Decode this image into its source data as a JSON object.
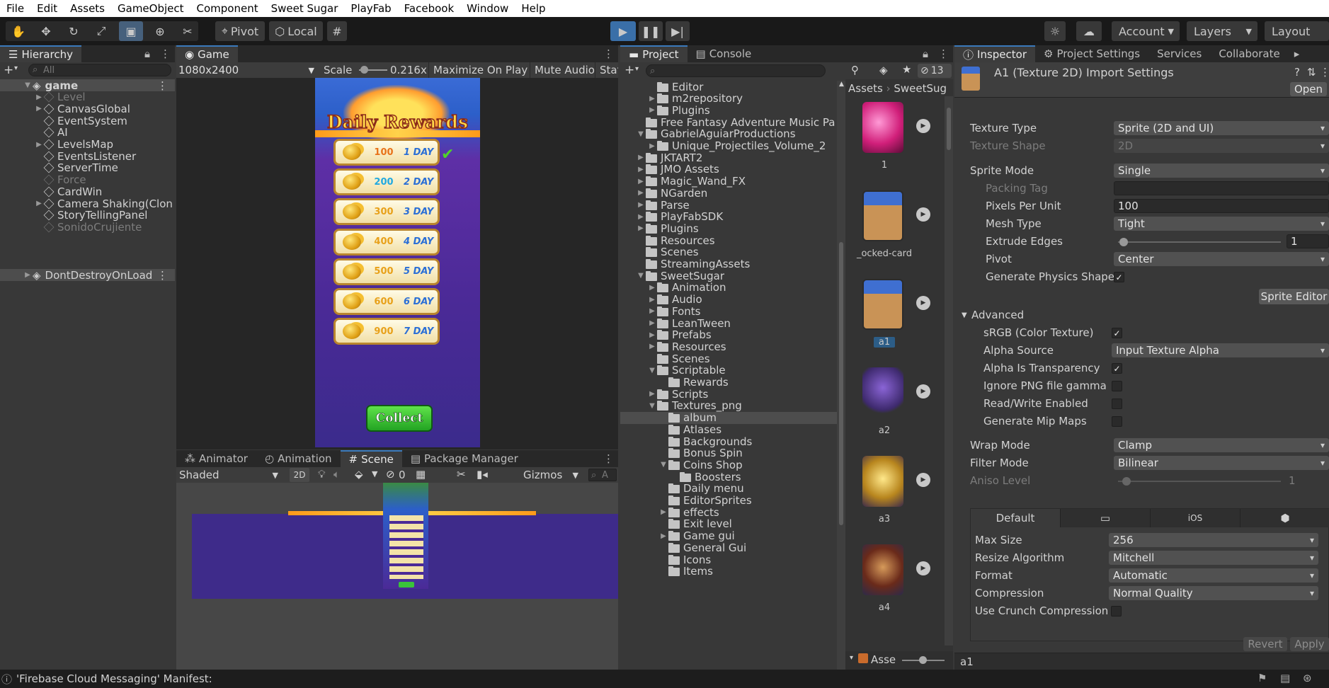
{
  "menubar": [
    "File",
    "Edit",
    "Assets",
    "GameObject",
    "Component",
    "Sweet Sugar",
    "PlayFab",
    "Facebook",
    "Window",
    "Help"
  ],
  "toolbar": {
    "pivot": "Pivot",
    "local": "Local",
    "account": "Account",
    "layers": "Layers",
    "layout": "Layout"
  },
  "hierarchy": {
    "tab": "Hierarchy",
    "search_placeholder": "All",
    "items": [
      {
        "label": "game",
        "depth": 0,
        "expand": "open",
        "kind": "scene",
        "selected": true
      },
      {
        "label": "Level",
        "depth": 1,
        "expand": "closed",
        "kind": "go",
        "dim": true
      },
      {
        "label": "CanvasGlobal",
        "depth": 1,
        "expand": "closed",
        "kind": "go"
      },
      {
        "label": "EventSystem",
        "depth": 1,
        "expand": "",
        "kind": "go"
      },
      {
        "label": "AI",
        "depth": 1,
        "expand": "",
        "kind": "go"
      },
      {
        "label": "LevelsMap",
        "depth": 1,
        "expand": "closed",
        "kind": "go"
      },
      {
        "label": "EventsListener",
        "depth": 1,
        "expand": "",
        "kind": "go"
      },
      {
        "label": "ServerTime",
        "depth": 1,
        "expand": "",
        "kind": "go"
      },
      {
        "label": "Force",
        "depth": 1,
        "expand": "",
        "kind": "go",
        "dim": true
      },
      {
        "label": "CardWin",
        "depth": 1,
        "expand": "",
        "kind": "go"
      },
      {
        "label": "Camera Shaking(Clon",
        "depth": 1,
        "expand": "closed",
        "kind": "go"
      },
      {
        "label": "StoryTellingPanel",
        "depth": 1,
        "expand": "",
        "kind": "go"
      },
      {
        "label": "SonidoCrujiente",
        "depth": 1,
        "expand": "",
        "kind": "go",
        "dim": true
      },
      {
        "label": "DontDestroyOnLoad",
        "depth": 0,
        "expand": "closed",
        "kind": "scene",
        "selected": true
      }
    ]
  },
  "game": {
    "tab": "Game",
    "resolution": "1080x2400",
    "scale_label": "Scale",
    "scale_value": "0.216x",
    "maximize": "Maximize On Play",
    "mute": "Mute Audio",
    "stats": "Stats",
    "title": "Daily Rewards",
    "collect": "Collect",
    "rewards": [
      {
        "amount": "100",
        "day": "1 DAY",
        "color": "#e8731a"
      },
      {
        "amount": "200",
        "day": "2 DAY",
        "color": "#21a9e0"
      },
      {
        "amount": "300",
        "day": "3 DAY",
        "color": "#e8a11a"
      },
      {
        "amount": "400",
        "day": "4 DAY",
        "color": "#e8a11a"
      },
      {
        "amount": "500",
        "day": "5 DAY",
        "color": "#e8a11a"
      },
      {
        "amount": "600",
        "day": "6 DAY",
        "color": "#e8a11a"
      },
      {
        "amount": "900",
        "day": "7 DAY",
        "color": "#e8a11a"
      }
    ]
  },
  "bottom_tabs": {
    "animator": "Animator",
    "animation": "Animation",
    "scene": "Scene",
    "package_manager": "Package Manager"
  },
  "scene_toolbar": {
    "shading": "Shaded",
    "mode2d": "2D",
    "hidden_count": "0",
    "gizmos": "Gizmos",
    "search": "A"
  },
  "project": {
    "tab": "Project",
    "console_tab": "Console",
    "hidden_count": "13",
    "breadcrumb": [
      "Assets",
      "SweetSug"
    ],
    "tree": [
      {
        "label": "Editor",
        "depth": 1,
        "expand": ""
      },
      {
        "label": "m2repository",
        "depth": 1,
        "expand": "closed"
      },
      {
        "label": "Plugins",
        "depth": 1,
        "expand": "closed"
      },
      {
        "label": "Free Fantasy Adventure Music Pa",
        "depth": 0,
        "expand": ""
      },
      {
        "label": "GabrielAguiarProductions",
        "depth": 0,
        "expand": "open"
      },
      {
        "label": "Unique_Projectiles_Volume_2",
        "depth": 1,
        "expand": "closed"
      },
      {
        "label": "JKTART2",
        "depth": 0,
        "expand": "closed"
      },
      {
        "label": "JMO Assets",
        "depth": 0,
        "expand": "closed"
      },
      {
        "label": "Magic_Wand_FX",
        "depth": 0,
        "expand": "closed"
      },
      {
        "label": "NGarden",
        "depth": 0,
        "expand": "closed"
      },
      {
        "label": "Parse",
        "depth": 0,
        "expand": "closed"
      },
      {
        "label": "PlayFabSDK",
        "depth": 0,
        "expand": "closed"
      },
      {
        "label": "Plugins",
        "depth": 0,
        "expand": "closed"
      },
      {
        "label": "Resources",
        "depth": 0,
        "expand": ""
      },
      {
        "label": "Scenes",
        "depth": 0,
        "expand": ""
      },
      {
        "label": "StreamingAssets",
        "depth": 0,
        "expand": ""
      },
      {
        "label": "SweetSugar",
        "depth": 0,
        "expand": "open"
      },
      {
        "label": "Animation",
        "depth": 1,
        "expand": "closed"
      },
      {
        "label": "Audio",
        "depth": 1,
        "expand": "closed"
      },
      {
        "label": "Fonts",
        "depth": 1,
        "expand": "closed"
      },
      {
        "label": "LeanTween",
        "depth": 1,
        "expand": "closed"
      },
      {
        "label": "Prefabs",
        "depth": 1,
        "expand": "closed"
      },
      {
        "label": "Resources",
        "depth": 1,
        "expand": "closed"
      },
      {
        "label": "Scenes",
        "depth": 1,
        "expand": ""
      },
      {
        "label": "Scriptable",
        "depth": 1,
        "expand": "open"
      },
      {
        "label": "Rewards",
        "depth": 2,
        "expand": ""
      },
      {
        "label": "Scripts",
        "depth": 1,
        "expand": "closed"
      },
      {
        "label": "Textures_png",
        "depth": 1,
        "expand": "open"
      },
      {
        "label": "album",
        "depth": 2,
        "expand": "",
        "selected": true
      },
      {
        "label": "Atlases",
        "depth": 2,
        "expand": ""
      },
      {
        "label": "Backgrounds",
        "depth": 2,
        "expand": ""
      },
      {
        "label": "Bonus Spin",
        "depth": 2,
        "expand": ""
      },
      {
        "label": "Coins Shop",
        "depth": 2,
        "expand": "open"
      },
      {
        "label": "Boosters",
        "depth": 3,
        "expand": ""
      },
      {
        "label": "Daily menu",
        "depth": 2,
        "expand": ""
      },
      {
        "label": "EditorSprites",
        "depth": 2,
        "expand": ""
      },
      {
        "label": "effects",
        "depth": 2,
        "expand": "closed"
      },
      {
        "label": "Exit level",
        "depth": 2,
        "expand": ""
      },
      {
        "label": "Game gui",
        "depth": 2,
        "expand": "closed"
      },
      {
        "label": "General Gui",
        "depth": 2,
        "expand": ""
      },
      {
        "label": "Icons",
        "depth": 2,
        "expand": ""
      },
      {
        "label": "Items",
        "depth": 2,
        "expand": ""
      }
    ],
    "assets": [
      {
        "label": "1",
        "kind": "gem"
      },
      {
        "label": "_ocked-card",
        "kind": "card"
      },
      {
        "label": "a1",
        "kind": "card",
        "selected": true
      },
      {
        "label": "a2",
        "kind": "knight"
      },
      {
        "label": "a3",
        "kind": "gold"
      },
      {
        "label": "a4",
        "kind": "dark"
      }
    ],
    "footer_label": "Asse"
  },
  "inspector": {
    "tabs": [
      "Inspector",
      "Project Settings",
      "Services",
      "Collaborate"
    ],
    "title": "A1 (Texture 2D) Import Settings",
    "open": "Open",
    "texture_type": {
      "label": "Texture Type",
      "value": "Sprite (2D and UI)"
    },
    "texture_shape": {
      "label": "Texture Shape",
      "value": "2D"
    },
    "sprite_mode": {
      "label": "Sprite Mode",
      "value": "Single"
    },
    "packing_tag": {
      "label": "Packing Tag",
      "value": ""
    },
    "ppu": {
      "label": "Pixels Per Unit",
      "value": "100"
    },
    "mesh_type": {
      "label": "Mesh Type",
      "value": "Tight"
    },
    "extrude": {
      "label": "Extrude Edges",
      "value": "1",
      "fraction": 0.0
    },
    "pivot": {
      "label": "Pivot",
      "value": "Center"
    },
    "physics": {
      "label": "Generate Physics Shape",
      "checked": true
    },
    "sprite_editor": "Sprite Editor",
    "advanced": "Advanced",
    "srgb": {
      "label": "sRGB (Color Texture)",
      "checked": true
    },
    "alpha_source": {
      "label": "Alpha Source",
      "value": "Input Texture Alpha"
    },
    "alpha_transp": {
      "label": "Alpha Is Transparency",
      "checked": true
    },
    "ignore_png": {
      "label": "Ignore PNG file gamma",
      "checked": false
    },
    "readwrite": {
      "label": "Read/Write Enabled",
      "checked": false
    },
    "mipmaps": {
      "label": "Generate Mip Maps",
      "checked": false
    },
    "wrap": {
      "label": "Wrap Mode",
      "value": "Clamp"
    },
    "filter": {
      "label": "Filter Mode",
      "value": "Bilinear"
    },
    "aniso": {
      "label": "Aniso Level",
      "value": "1"
    },
    "platform_tabs": [
      "Default",
      "",
      "iOS",
      ""
    ],
    "max_size": {
      "label": "Max Size",
      "value": "256"
    },
    "resize": {
      "label": "Resize Algorithm",
      "value": "Mitchell"
    },
    "format": {
      "label": "Format",
      "value": "Automatic"
    },
    "compression": {
      "label": "Compression",
      "value": "Normal Quality"
    },
    "crunch": {
      "label": "Use Crunch Compression",
      "checked": false
    },
    "revert": "Revert",
    "apply": "Apply",
    "preview_label": "a1"
  },
  "status": "'Firebase Cloud Messaging' Manifest:"
}
